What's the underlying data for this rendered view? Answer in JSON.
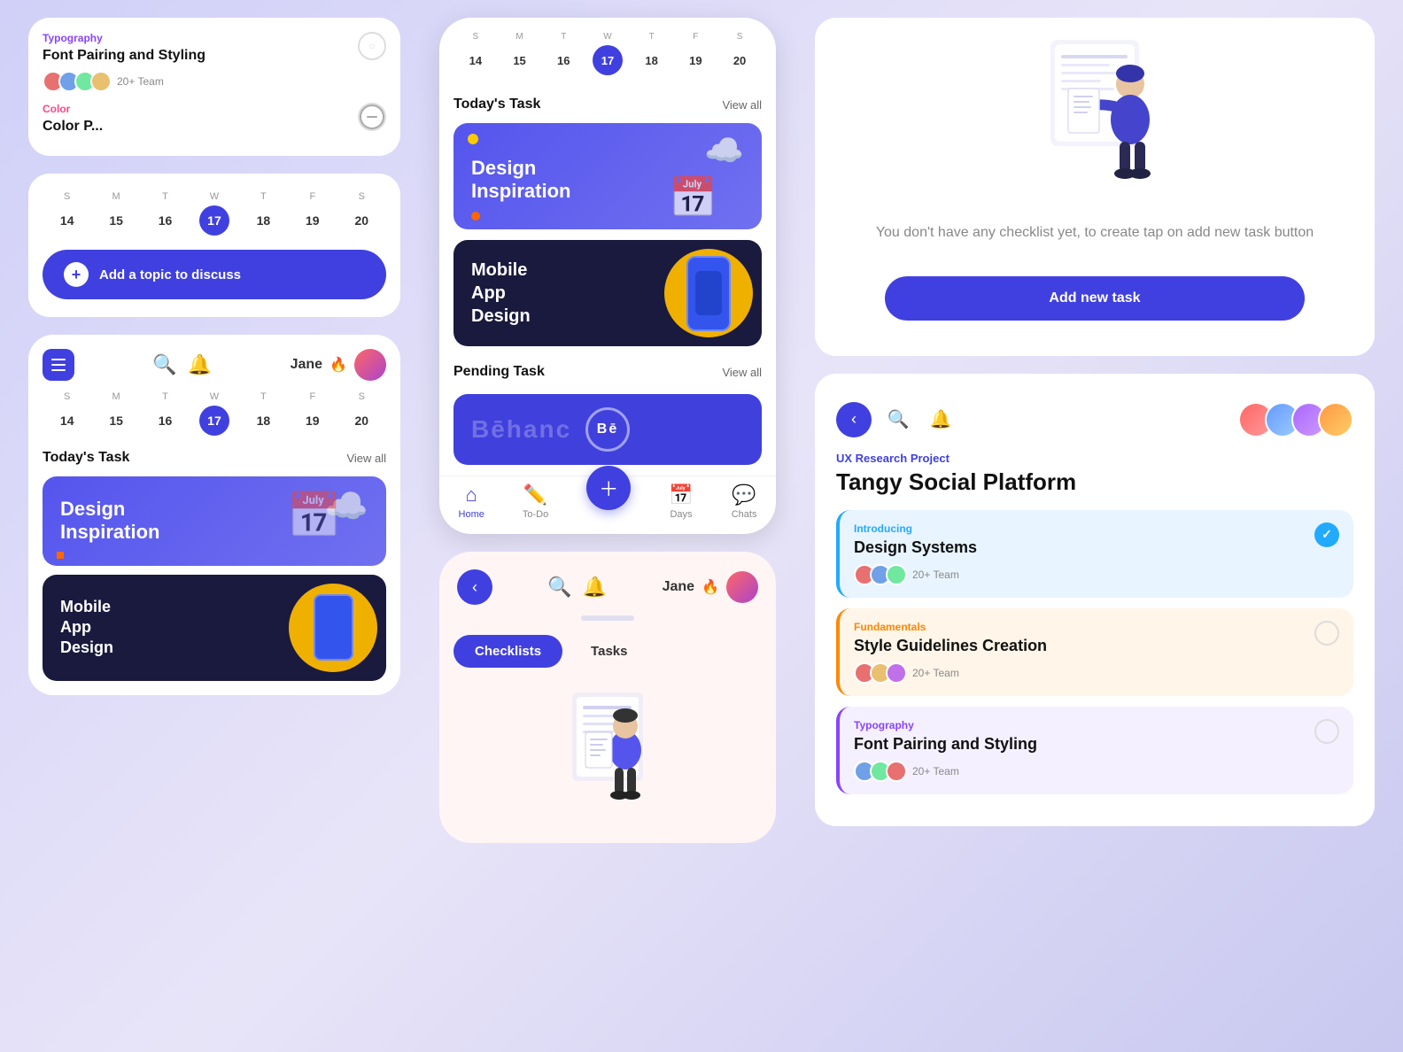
{
  "col1": {
    "top_card": {
      "category1": "Typography",
      "task1_title": "Font Pairing and Styling",
      "team1": "20+ Team",
      "category2": "Color",
      "task2_title": "Color P..."
    },
    "week": {
      "days": [
        "S",
        "M",
        "T",
        "W",
        "T",
        "F",
        "S"
      ],
      "dates": [
        14,
        15,
        16,
        17,
        18,
        19,
        20
      ],
      "active": 17
    },
    "add_topic_btn": "Add a topic to discuss",
    "bottom_card": {
      "header_user": "Jane",
      "today_tasks_title": "Today's Task",
      "view_all": "View all",
      "card1_title": "Design\nInspiration",
      "card2_title": "Mobile\nApp\nDesign"
    }
  },
  "col2": {
    "top_phone": {
      "today_task_title": "Today's Task",
      "view_all": "View all",
      "card1_title": "Design\nInspiration",
      "card2_title": "Mobile\nApp\nDesign",
      "pending_task_title": "Pending Task",
      "pending_view_all": "View all",
      "nav": {
        "home": "Home",
        "todo": "To-Do",
        "days": "Days",
        "chats": "Chats"
      }
    },
    "bottom_phone": {
      "checklists_tab": "Checklists",
      "tasks_tab": "Tasks"
    }
  },
  "col3": {
    "empty_state_text": "You don't have any checklist yet, to create tap on add new task button",
    "add_task_btn": "Add new task",
    "project_card": {
      "category": "UX Research Project",
      "title": "Tangy Social Platform",
      "tasks": [
        {
          "category": "Introducing",
          "category_color": "introducing",
          "title": "Design Systems",
          "team": "20+ Team",
          "checked": true
        },
        {
          "category": "Fundamentals",
          "category_color": "fundamentals",
          "title": "Style Guidelines Creation",
          "team": "20+ Team",
          "checked": false
        },
        {
          "category": "Typography",
          "category_color": "typography",
          "title": "Font Pairing and Styling",
          "team": "20+ Team",
          "checked": false
        }
      ]
    }
  }
}
